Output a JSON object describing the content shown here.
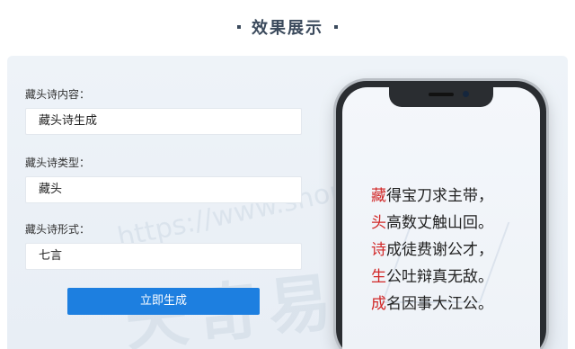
{
  "header": {
    "title": "效果展示"
  },
  "form": {
    "content_label": "藏头诗内容：",
    "content_value": "藏头诗生成",
    "type_label": "藏头诗类型：",
    "type_value": "藏头",
    "form_label": "藏头诗形式：",
    "form_value": "七言",
    "submit_label": "立即生成"
  },
  "watermark": {
    "url": "https://www.shopxx",
    "big": "天奇易网"
  },
  "poem": {
    "lines": [
      {
        "first": "藏",
        "rest": "得宝刀求主带，"
      },
      {
        "first": "头",
        "rest": "高数丈触山回。"
      },
      {
        "first": "诗",
        "rest": "成徒费谢公才，"
      },
      {
        "first": "生",
        "rest": "公吐辩真无敌。"
      },
      {
        "first": "成",
        "rest": "名因事大江公。"
      }
    ]
  },
  "colors": {
    "accent": "#1d7fe0",
    "poem_highlight": "#d12828"
  }
}
